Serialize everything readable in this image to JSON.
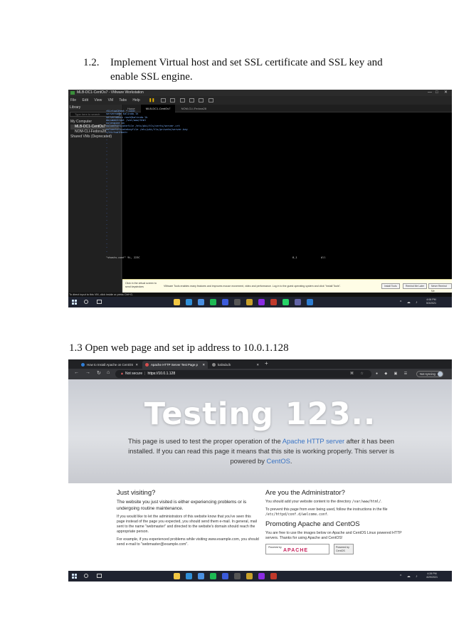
{
  "section1": {
    "number": "1.2.",
    "line1": "Implement Virtual host and set SSL certificate and SSL key and",
    "line2": "enable SSL engine."
  },
  "section2": {
    "heading": "1.3 Open web page and set ip address to 10.0.1.128"
  },
  "vmware": {
    "window_title": "MLB-DC1-CentOs7 - VMware Workstation",
    "menu": [
      "File",
      "Edit",
      "View",
      "VM",
      "Tabs",
      "Help"
    ],
    "library_label": "Library",
    "library_search": "Type here to search",
    "tree": [
      "My Computer",
      "MLB-DC1-CentOs7",
      "NOM-CLI-Fedora28",
      "Shared VMs (Deprecated)"
    ],
    "tabs": [
      "Home",
      "MLB-DC1-CentOs7",
      "NOM-CLI-Fedora28"
    ],
    "terminal_lines": [
      "<VirtualHost *:443>",
      "servername kalinda.lk",
      "serveradmin root@kalinda.lk",
      "documentroot /var/www/html",
      "sslengine on",
      "sslcertificatefile /etc/pki/tls/certs/server.crt",
      "sslcertificatekeyfile /etc/pki/tls/private/server.key",
      "</VirtualHost>"
    ],
    "status_file": "\"vhosts.conf\" 9L, 223C",
    "status_pos": "8,1",
    "status_pct": "All",
    "notice_left": "Click in the virtual screen to send keystrokes",
    "notice_msg": "VMware Tools enables many features and improves mouse movement, video and performance. Log in to the guest operating system and click \"Install Tools\".",
    "notice_buttons": [
      "Install Tools",
      "Remind Me Later",
      "Never Remind Me"
    ],
    "status_bar": "To direct input to this VM, click inside or press Ctrl+G.",
    "clock_time": "4:08 PM",
    "clock_date": "5/3/2021"
  },
  "browser": {
    "tabs": [
      "How to Install Apache on CentOS",
      "Apache HTTP Server Test Page p",
      "kalinda.lk"
    ],
    "not_secure": "Not secure",
    "url": "https://10.0.1.128",
    "not_syncing": "Not syncing",
    "hero_title": "Testing 123..",
    "hero_text_1": "This page is used to test the proper operation of the ",
    "hero_link_1": "Apache HTTP server",
    "hero_text_2": " after it has been installed. If you can read this page it means that this site is working properly. This server is powered by ",
    "hero_link_2": "CentOS",
    "hero_text_3": ".",
    "left": {
      "heading": "Just visiting?",
      "lead": "The website you just visited is either experiencing problems or is undergoing routine maintenance.",
      "p1": "If you would like to let the administrators of this website know that you've seen this page instead of the page you expected, you should send them e-mail. In general, mail sent to the name \"webmaster\" and directed to the website's domain should reach the appropriate person.",
      "p2": "For example, if you experienced problems while visiting www.example.com, you should send e-mail to \"webmaster@example.com\"."
    },
    "right": {
      "heading": "Are you the Administrator?",
      "p1a": "You should add your website content to the directory ",
      "p1b": "/var/www/html/",
      "p1c": ".",
      "p2": "To prevent this page from ever being used, follow the instructions in the file",
      "p2_path": "/etc/httpd/conf.d/welcome.conf",
      "p2_end": ".",
      "heading2": "Promoting Apache and CentOS",
      "p3": "You are free to use the images below on Apache and CentOS Linux powered HTTP servers. Thanks for using Apache and CentOS!",
      "powered_by": "Powered by",
      "apache": "APACHE",
      "centos_powered": "Powered by",
      "centos": "CentOS"
    },
    "clock_time": "4:28 PM",
    "clock_date": "4/29/2021"
  }
}
